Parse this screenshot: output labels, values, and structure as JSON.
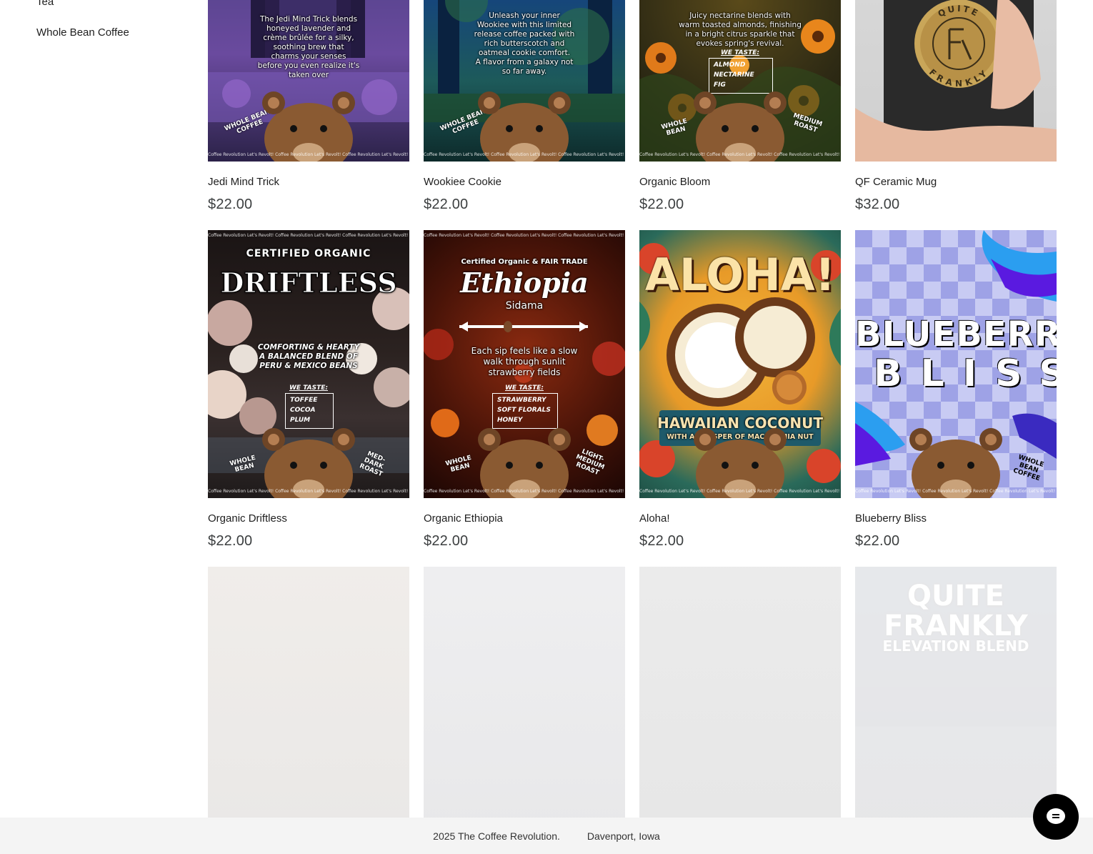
{
  "sidebar": {
    "items": [
      {
        "label": "Tea"
      },
      {
        "label": "Whole Bean Coffee"
      }
    ]
  },
  "products": [
    {
      "name": "Jedi Mind Trick",
      "price": "$22.00",
      "image_text": [
        "The Jedi Mind Trick blends",
        "honeyed lavender and",
        "crème brûlée for a silky,",
        "soothing brew that",
        "charms your senses",
        "before you even realize it's",
        "taken over"
      ]
    },
    {
      "name": "Wookiee Cookie",
      "price": "$22.00",
      "image_text": [
        "Unleash your inner",
        "Wookiee with this limited",
        "release coffee packed with",
        "rich butterscotch and",
        "oatmeal cookie comfort.",
        "A flavor from a galaxy not",
        "so far away."
      ]
    },
    {
      "name": "Organic Bloom",
      "price": "$22.00",
      "image_text": [
        "Juicy nectarine blends with",
        "warm toasted almonds, finishing",
        "in a bright citrus sparkle that",
        "evokes spring's revival."
      ],
      "taste": [
        "ALMOND",
        "NECTARINE",
        "FIG"
      ]
    },
    {
      "name": "QF Ceramic Mug",
      "price": "$32.00",
      "image_text": [
        "QUITE",
        "FRANKLY"
      ]
    },
    {
      "name": "Organic Driftless",
      "price": "$22.00",
      "image_text": [
        "CERTIFIED ORGANIC",
        "DRIFTLESS",
        "COMFORTING & HEARTY",
        "A BALANCED BLEND OF",
        "PERU & MEXICO BEANS"
      ],
      "taste": [
        "TOFFEE",
        "COCOA",
        "PLUM"
      ]
    },
    {
      "name": "Organic Ethiopia",
      "price": "$22.00",
      "image_text": [
        "Certified Organic & FAIR TRADE",
        "Ethiopia",
        "Sidama",
        "Each sip feels like a slow",
        "walk through sunlit",
        "strawberry fields"
      ],
      "taste": [
        "STRAWBERRY",
        "SOFT FLORALS",
        "HONEY"
      ]
    },
    {
      "name": "Aloha!",
      "price": "$22.00",
      "image_text": [
        "ALOHA!",
        "HAWAIIAN COCONUT",
        "WITH A WHISPER OF MACADAMIA NUT"
      ]
    },
    {
      "name": "Blueberry Bliss",
      "price": "$22.00",
      "image_text": [
        "BLUEBERRY",
        "BLISS"
      ]
    },
    {
      "name": "",
      "price": "",
      "image_text": []
    },
    {
      "name": "",
      "price": "",
      "image_text": []
    },
    {
      "name": "",
      "price": "",
      "image_text": []
    },
    {
      "name": "",
      "price": "",
      "image_text": [
        "QUITE",
        "FRANKLY",
        "ELEVATION BLEND"
      ]
    }
  ],
  "common": {
    "whole_bean": "WHOLE BEAN COFFEE",
    "whole_bean_short": "WHOLE BEAN",
    "we_taste": "WE TASTE:",
    "strip": "Coffee Revolution   Let's Revolt!   Coffee Revolution   Let's Revolt!   Coffee Revolution   Let's Revolt!   Coffee Revolution",
    "medium_roast": "MEDIUM ROAST",
    "med_dark_roast": "MED-DARK ROAST",
    "light_medium_roast": "LIGHT-MEDIUM ROAST"
  },
  "footer": {
    "copyright": "2025 The Coffee Revolution.",
    "location": "Davenport, Iowa"
  },
  "colors": {
    "price_text": "#3c3f40",
    "footer_bg": "#f4f4f4",
    "chat_button": "#000000"
  },
  "icons": {
    "chat": "chat-bubble-icon"
  }
}
